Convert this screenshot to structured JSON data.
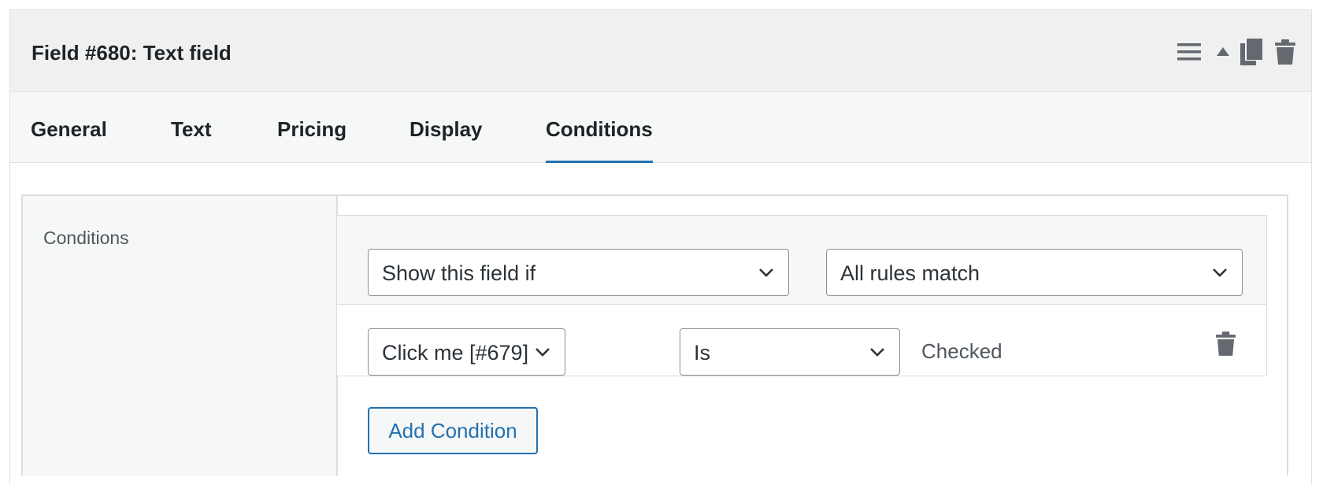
{
  "panel": {
    "title": "Field #680: Text field",
    "actions": [
      "menu-icon",
      "collapse-up-icon",
      "duplicate-icon",
      "trash-icon"
    ]
  },
  "tabs": [
    {
      "label": "General",
      "active": false
    },
    {
      "label": "Text",
      "active": false
    },
    {
      "label": "Pricing",
      "active": false
    },
    {
      "label": "Display",
      "active": false
    },
    {
      "label": "Conditions",
      "active": true
    }
  ],
  "settings": {
    "label": "Conditions"
  },
  "conditions": {
    "visibility_select": {
      "value": "Show this field if"
    },
    "match_select": {
      "value": "All rules match"
    },
    "rules": [
      {
        "field_select": "Click me [#679]",
        "operator_select": "Is",
        "value_text": "Checked"
      }
    ],
    "add_button_label": "Add Condition"
  },
  "colors": {
    "accent": "#2271b1",
    "header_bg": "#f0f0f1",
    "tab_bg": "#f6f7f7",
    "icon_gray": "#646970",
    "border": "#dcdcde"
  }
}
